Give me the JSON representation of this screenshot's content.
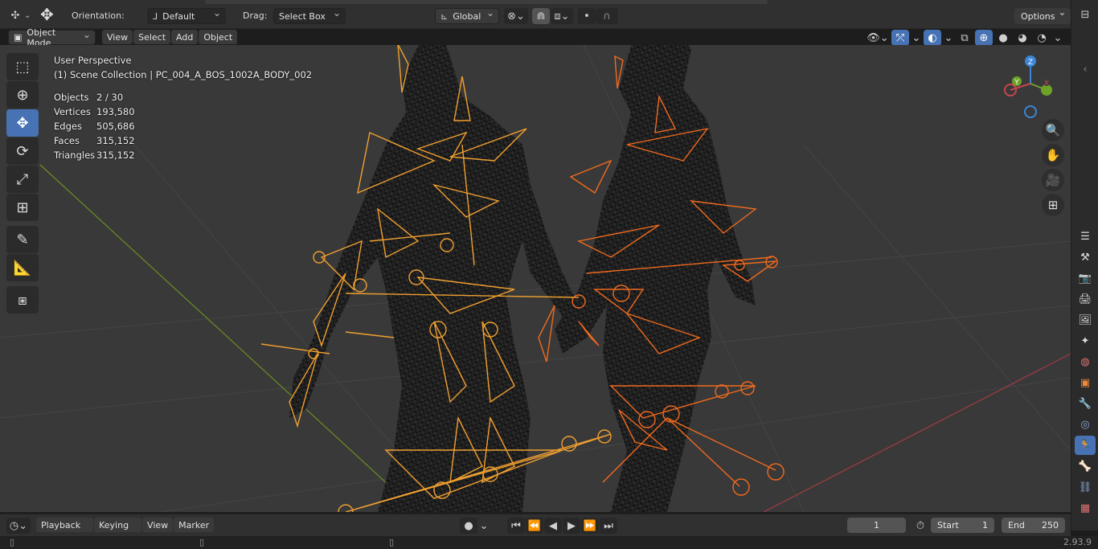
{
  "header": {
    "orientation_label": "Orientation:",
    "orientation_value": "Default",
    "drag_label": "Drag:",
    "drag_value": "Select Box",
    "transform_space": "Global",
    "options_label": "Options"
  },
  "viewport_header": {
    "mode": "Object Mode",
    "menus": [
      "View",
      "Select",
      "Add",
      "Object"
    ]
  },
  "viewport_info": {
    "perspective": "User Perspective",
    "collection": "(1) Scene Collection | PC_004_A_BOS_1002A_BODY_002",
    "stats": [
      {
        "label": "Objects",
        "value": "2 / 30"
      },
      {
        "label": "Vertices",
        "value": "193,580"
      },
      {
        "label": "Edges",
        "value": "505,686"
      },
      {
        "label": "Faces",
        "value": "315,152"
      },
      {
        "label": "Triangles",
        "value": "315,152"
      }
    ]
  },
  "gizmo": {
    "x_label": "X",
    "y_label": "Y",
    "z_label": "Z"
  },
  "timeline": {
    "menus": [
      "Playback",
      "Keying",
      "View",
      "Marker"
    ],
    "current_frame": "1",
    "start_label": "Start",
    "start_value": "1",
    "end_label": "End",
    "end_value": "250"
  },
  "status_bar": {
    "version": "2.93.9"
  },
  "colors": {
    "accent": "#4772b3",
    "armature_selected": "#f0a030",
    "armature_active": "#f06a1e",
    "axis_x": "#c6454f",
    "axis_y": "#6ea32a"
  }
}
